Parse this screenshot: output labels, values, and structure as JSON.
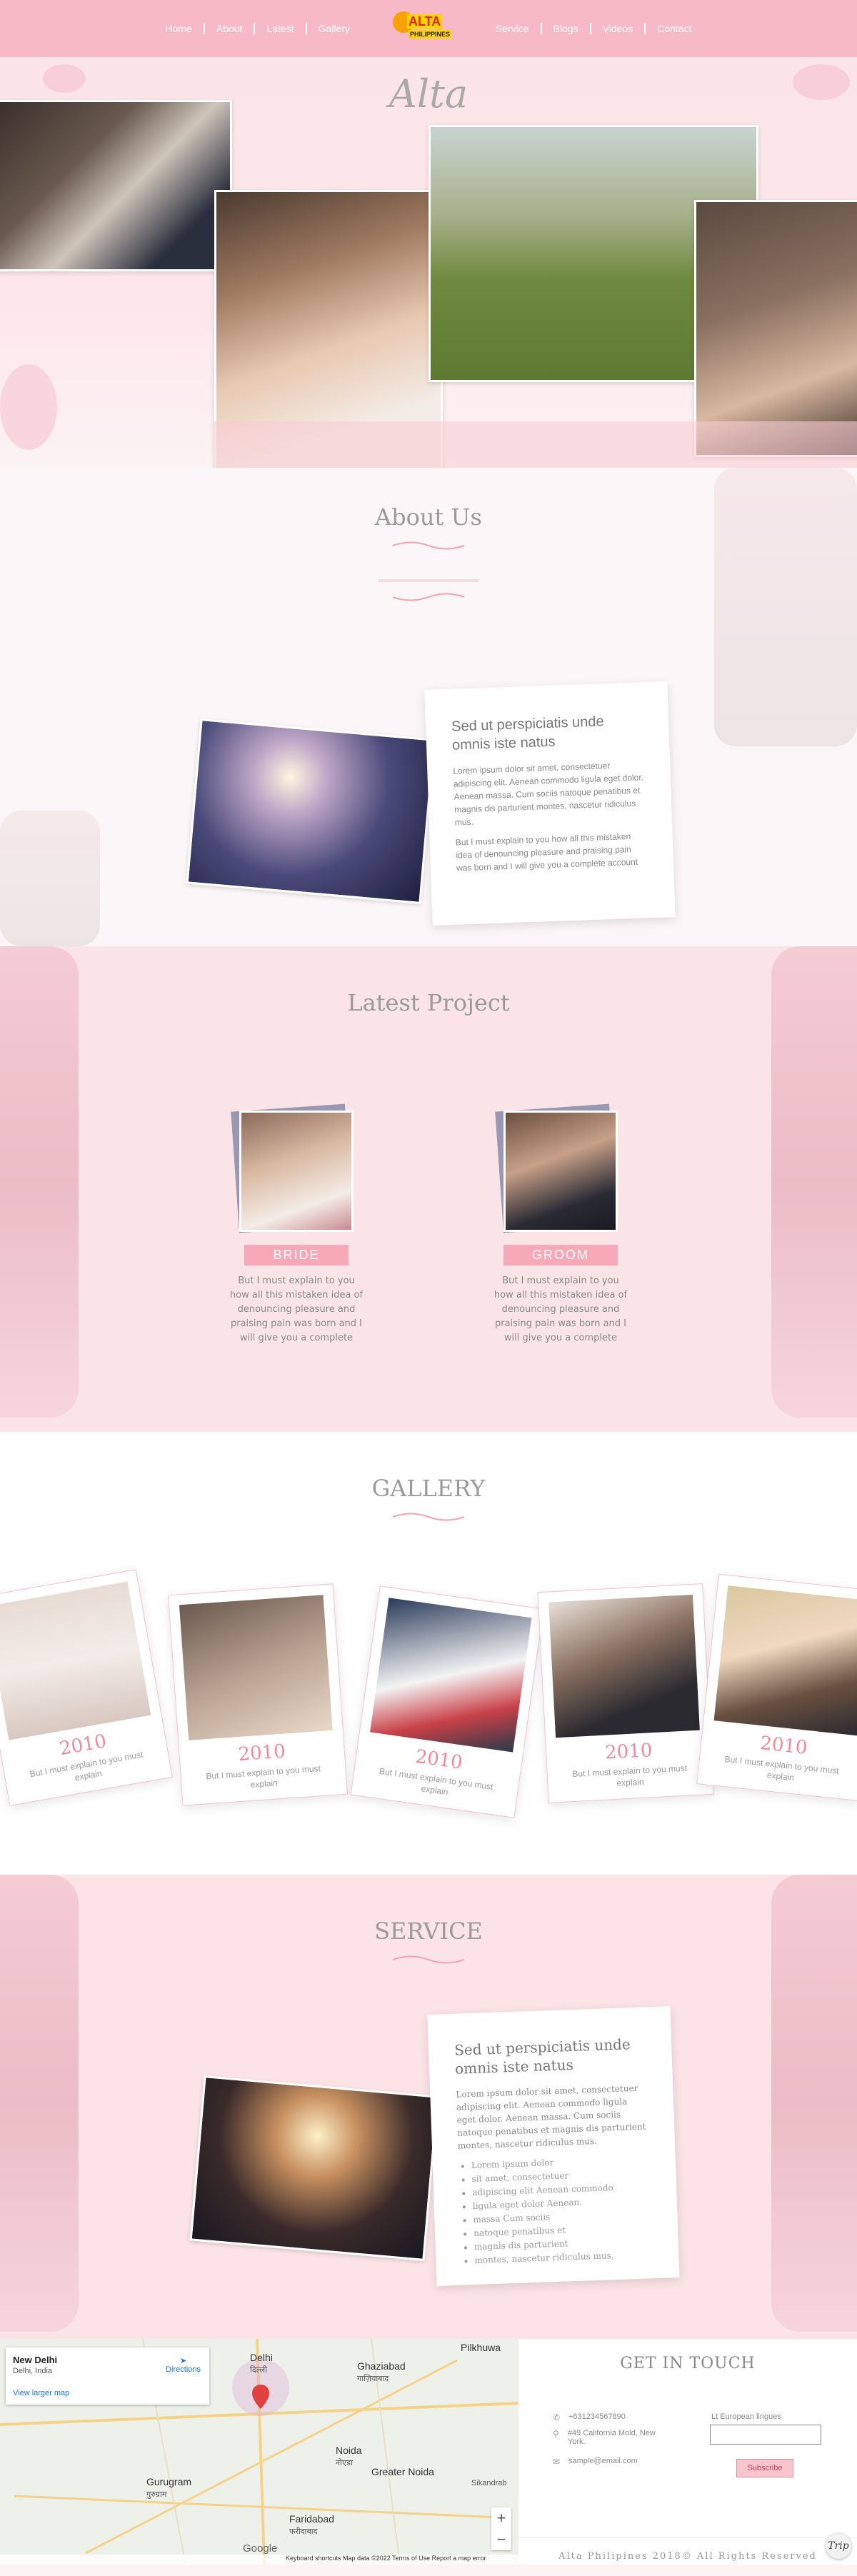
{
  "nav": {
    "left": [
      "Home",
      "About",
      "Latest",
      "Gallery"
    ],
    "right": [
      "Service",
      "Blogs",
      "Videos",
      "Contact"
    ],
    "logo": {
      "brand": "ALTA",
      "sub": "PHILIPPINES"
    }
  },
  "hero": {
    "title": "Alta"
  },
  "about": {
    "title": "About Us",
    "heading": "Sed ut perspiciatis unde omnis iste natus",
    "p1": "Lorem ipsum dolor sit amet, consectetuer adipiscing elit. Aenean commodo ligula eget dolor. Aenean massa. Cum sociis natoque penatibus et magnis dis parturient montes, nascetur ridiculus mus.",
    "p2": "But I must explain to you how all this mistaken idea of denouncing pleasure and praising pain was born and I will give you a complete account"
  },
  "project": {
    "title": "Latest Project",
    "items": [
      {
        "label": "BRIDE",
        "text": "But I must explain to you how all this mistaken idea of denouncing pleasure and praising pain was born and I will give you a complete"
      },
      {
        "label": "GROOM",
        "text": "But I must explain to you how all this mistaken idea of denouncing pleasure and praising pain was born and I will give you a complete"
      }
    ]
  },
  "gallery": {
    "title": "GALLERY",
    "items": [
      {
        "year": "2010",
        "caption": "But I must explain to you must explain"
      },
      {
        "year": "2010",
        "caption": "But I must explain to you must explain"
      },
      {
        "year": "2010",
        "caption": "But I must explain to you must explain"
      },
      {
        "year": "2010",
        "caption": "But I must explain to you must explain"
      },
      {
        "year": "2010",
        "caption": "But I must explain to you must explain"
      }
    ]
  },
  "service": {
    "title": "SERVICE",
    "heading": "Sed ut perspiciatis unde omnis iste natus",
    "p": "Lorem ipsum dolor sit amet, consectetuer adipiscing elit. Aenean commodo ligula eget dolor. Aenean massa. Cum sociis natoque penatibus et magnis dis parturient montes, nascetur ridiculus mus.",
    "list": [
      "Lorem ipsum dolor",
      "sit amet, consectetuer",
      "adipiscing elit Aenean commodo",
      "ligula eget dolor Aenean.",
      "massa Cum sociis",
      "natoque penatibus et",
      "magnis dis parturient",
      "montes, nascetur ridiculus mus."
    ]
  },
  "map": {
    "place": "New Delhi",
    "region": "Delhi, India",
    "larger": "View larger map",
    "directions": "Directions",
    "labels": [
      "Delhi",
      "दिल्ली",
      "Ghaziabad",
      "गाज़ियाबाद",
      "Noida",
      "नोएडा",
      "Greater Noida",
      "Gurugram",
      "गुरुग्राम",
      "Faridabad",
      "फरीदाबाद",
      "Pilkhuwa",
      "Sikandrab"
    ],
    "google": "Google",
    "footer": "Keyboard shortcuts   Map data ©2022   Terms of Use   Report a map error"
  },
  "contact": {
    "title": "GET IN TOUCH",
    "phone": "+631234567890",
    "address": "#49 California Mold, New York.",
    "email": "sample@email.com",
    "newsletter_label": "Lt European lingues",
    "subscribe": "Subscribe",
    "copyright": "Alta Philipines 2018© All Rights Reserved",
    "badge": "Trip"
  },
  "colors": {
    "nav": "#f8b9c6",
    "accent": "#f7a9b8",
    "year": "#f4879b"
  }
}
